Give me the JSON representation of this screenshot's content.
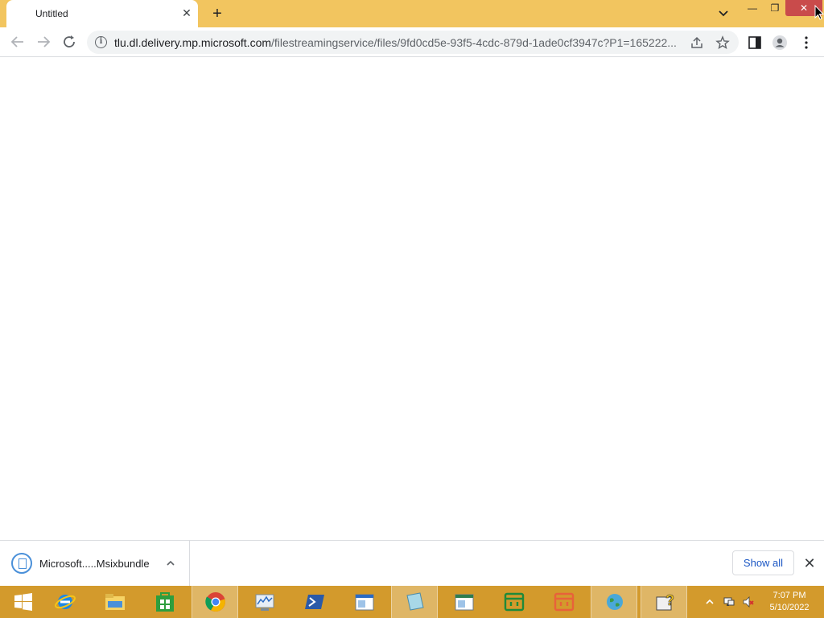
{
  "browser": {
    "tab_title": "Untitled",
    "tab_close": "✕",
    "new_tab": "+",
    "window_controls": {
      "minimize": "—",
      "maximize": "❐",
      "close": "✕"
    }
  },
  "toolbar": {
    "url_host": "tlu.dl.delivery.mp.microsoft.com",
    "url_path": "/filestreamingservice/files/9fd0cd5e-93f5-4cdc-879d-1ade0cf3947c?P1=165222...",
    "info_icon": "i"
  },
  "download_bar": {
    "file_name": "Microsoft.....Msixbundle",
    "show_all": "Show all",
    "close": "✕"
  },
  "taskbar": {
    "apps": [
      {
        "name": "start-button"
      },
      {
        "name": "internet-explorer-icon"
      },
      {
        "name": "file-explorer-icon"
      },
      {
        "name": "store-icon"
      },
      {
        "name": "chrome-icon",
        "active": true
      },
      {
        "name": "performance-monitor-icon"
      },
      {
        "name": "powershell-icon"
      },
      {
        "name": "document-app-icon"
      },
      {
        "name": "notepad-icon",
        "active": true
      },
      {
        "name": "document-app-2-icon"
      },
      {
        "name": "green-tray-app-icon"
      },
      {
        "name": "orange-tray-app-icon"
      },
      {
        "name": "network-globe-icon",
        "active": true
      },
      {
        "name": "help-icon",
        "active": true
      }
    ],
    "clock_time": "7:07 PM",
    "clock_date": "5/10/2022"
  },
  "colors": {
    "tabstrip": "#f2c55f",
    "taskbar": "#d39a2c",
    "close_button": "#c94b4b",
    "link_blue": "#1a56c4"
  }
}
